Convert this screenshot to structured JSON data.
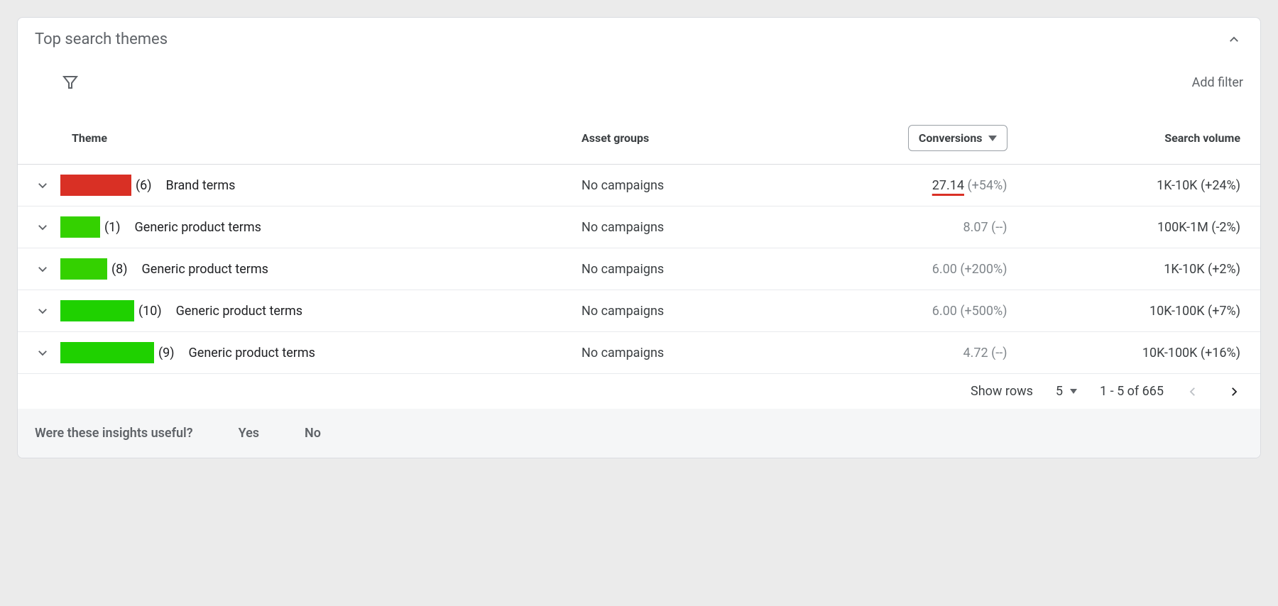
{
  "header": {
    "title": "Top search themes"
  },
  "filter_bar": {
    "add_filter": "Add filter"
  },
  "columns": {
    "theme": "Theme",
    "asset_groups": "Asset groups",
    "conversions": "Conversions",
    "search_volume": "Search volume"
  },
  "rows": [
    {
      "swatch_color": "#d93025",
      "swatch_width": 100,
      "count": "(6)",
      "label": "Brand terms",
      "asset_groups": "No campaigns",
      "conv_value": "27.14",
      "conv_change": "(+54%)",
      "conv_emph": true,
      "conv_grey": false,
      "volume": "1K-10K (+24%)"
    },
    {
      "swatch_color": "#34d100",
      "swatch_width": 56,
      "count": "(1)",
      "label": "Generic product terms",
      "asset_groups": "No campaigns",
      "conv_value": "8.07",
      "conv_change": "(--)",
      "conv_emph": false,
      "conv_grey": true,
      "volume": "100K-1M (-2%)"
    },
    {
      "swatch_color": "#34d100",
      "swatch_width": 66,
      "count": "(8)",
      "label": "Generic product terms",
      "asset_groups": "No campaigns",
      "conv_value": "6.00",
      "conv_change": "(+200%)",
      "conv_emph": false,
      "conv_grey": true,
      "volume": "1K-10K (+2%)"
    },
    {
      "swatch_color": "#1fd100",
      "swatch_width": 104,
      "count": "(10)",
      "label": "Generic product terms",
      "asset_groups": "No campaigns",
      "conv_value": "6.00",
      "conv_change": "(+500%)",
      "conv_emph": false,
      "conv_grey": true,
      "volume": "10K-100K (+7%)"
    },
    {
      "swatch_color": "#1fd100",
      "swatch_width": 132,
      "count": "(9)",
      "label": "Generic product terms",
      "asset_groups": "No campaigns",
      "conv_value": "4.72",
      "conv_change": "(--)",
      "conv_emph": false,
      "conv_grey": true,
      "volume": "10K-100K (+16%)"
    }
  ],
  "pagination": {
    "show_rows_label": "Show rows",
    "page_size": "5",
    "range": "1 - 5 of 665"
  },
  "feedback": {
    "question": "Were these insights useful?",
    "yes": "Yes",
    "no": "No"
  }
}
